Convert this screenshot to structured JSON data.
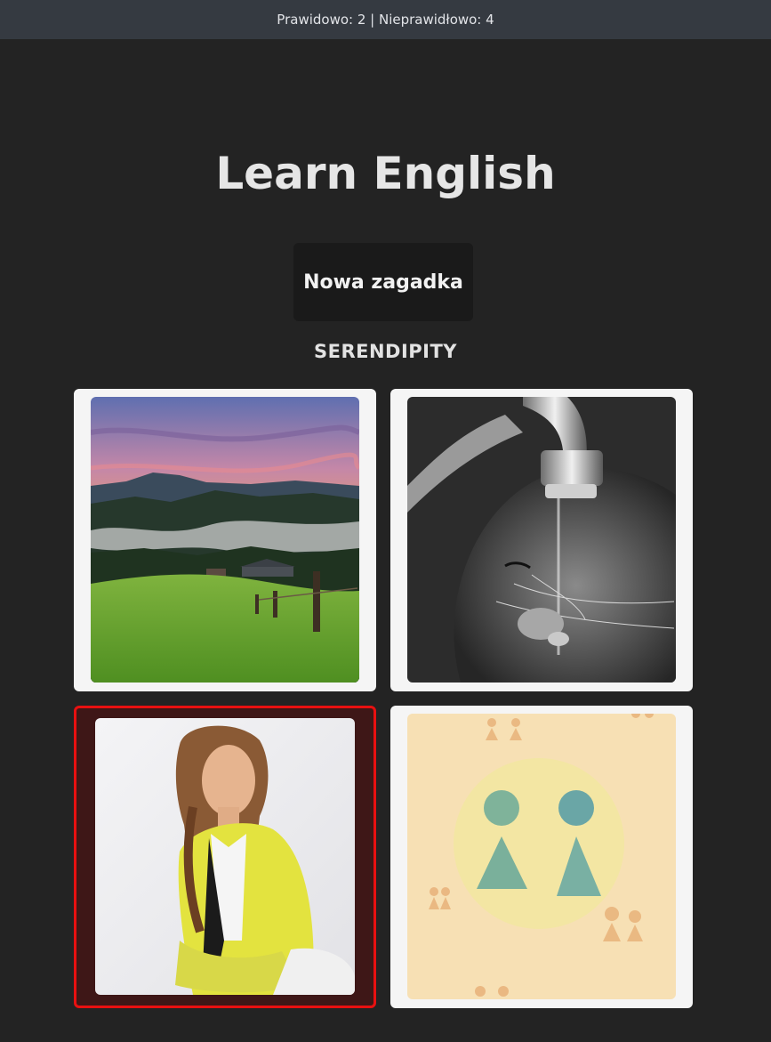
{
  "score": {
    "text": "Prawidowo: 2 | Nieprawidłowo: 4"
  },
  "title": "Learn English",
  "new_puzzle_button": "Nowa zagadka",
  "word": "SERENDIPITY",
  "colors": {
    "background": "#232323",
    "topbar": "#353a41",
    "card": "#f5f5f5",
    "wrong_border": "#e81010"
  },
  "cards": [
    {
      "picture": "mountain-landscape-sunset",
      "state": "neutral"
    },
    {
      "picture": "cat-drinking-from-tap",
      "state": "neutral"
    },
    {
      "picture": "woman-yellow-jacket",
      "state": "wrong"
    },
    {
      "picture": "watercolor-restroom-figures",
      "state": "neutral"
    }
  ]
}
